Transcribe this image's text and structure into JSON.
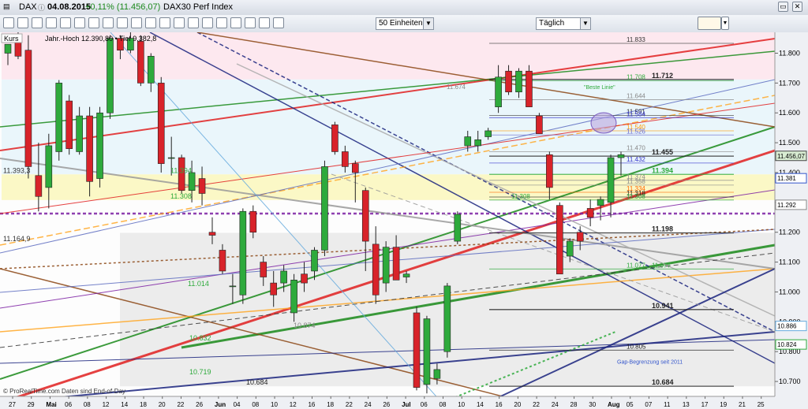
{
  "window": {
    "symbol": "DAX",
    "date": "04.08.2015",
    "change": "+0,11% (11.456,07)",
    "index_name": "DAX30 Perf Index"
  },
  "toolbar": {
    "units_select": "50 Einheiten",
    "period_select": "Täglich"
  },
  "chart_panel": {
    "panel_label": "Kurs",
    "info": "Jahr.-Hoch 12.390,80 • Tief 9.382,8",
    "footer_left": "© ProRealTime.com  Daten sind End-of-Day"
  },
  "colors": {
    "bull": "#2eaa3c",
    "bear": "#d8232a",
    "price_tag": "#d8ecd2",
    "accent_red": "#e02020",
    "accent_green": "#1a8a1a"
  },
  "chart_data": {
    "type": "candlestick",
    "x_ticks": [
      "27",
      "29",
      "Mai",
      "06",
      "08",
      "12",
      "14",
      "18",
      "20",
      "22",
      "26",
      "Jun",
      "04",
      "08",
      "10",
      "12",
      "16",
      "18",
      "22",
      "24",
      "26",
      "Jul",
      "06",
      "08",
      "10",
      "14",
      "16",
      "20",
      "22",
      "24",
      "28",
      "30",
      "Aug",
      "05",
      "07",
      "11",
      "13",
      "17",
      "19",
      "21",
      "25"
    ],
    "ylim": [
      10650,
      11870
    ],
    "y_ticks": [
      "10.700",
      "10.800",
      "10.900",
      "11.000",
      "11.100",
      "11.200",
      "11.300",
      "11.400",
      "11.500",
      "11.600",
      "11.700",
      "11.800"
    ],
    "candles": [
      {
        "o": 11800,
        "h": 11830,
        "l": 11760,
        "c": 11830
      },
      {
        "o": 11840,
        "h": 11870,
        "l": 11780,
        "c": 11790
      },
      {
        "o": 11810,
        "h": 11860,
        "l": 11380,
        "c": 11420
      },
      {
        "o": 11390,
        "h": 11500,
        "l": 11270,
        "c": 11320
      },
      {
        "o": 11350,
        "h": 11530,
        "l": 11280,
        "c": 11490
      },
      {
        "o": 11470,
        "h": 11710,
        "l": 11440,
        "c": 11700
      },
      {
        "o": 11640,
        "h": 11660,
        "l": 11460,
        "c": 11480
      },
      {
        "o": 11470,
        "h": 11620,
        "l": 11460,
        "c": 11590
      },
      {
        "o": 11590,
        "h": 11620,
        "l": 11320,
        "c": 11370
      },
      {
        "o": 11380,
        "h": 11620,
        "l": 11350,
        "c": 11600
      },
      {
        "o": 11600,
        "h": 11860,
        "l": 11580,
        "c": 11850
      },
      {
        "o": 11850,
        "h": 11860,
        "l": 11780,
        "c": 11810
      },
      {
        "o": 11810,
        "h": 11880,
        "l": 11800,
        "c": 11850
      },
      {
        "o": 11840,
        "h": 11860,
        "l": 11690,
        "c": 11700
      },
      {
        "o": 11700,
        "h": 11800,
        "l": 11670,
        "c": 11790
      },
      {
        "o": 11700,
        "h": 11720,
        "l": 11400,
        "c": 11430
      },
      {
        "o": 11450,
        "h": 11520,
        "l": 11390,
        "c": 11450
      },
      {
        "o": 11450,
        "h": 11460,
        "l": 11330,
        "c": 11340
      },
      {
        "o": 11340,
        "h": 11440,
        "l": 11300,
        "c": 11400
      },
      {
        "o": 11380,
        "h": 11420,
        "l": 11290,
        "c": 11330
      },
      {
        "o": 11200,
        "h": 11250,
        "l": 11160,
        "c": 11190
      },
      {
        "o": 11140,
        "h": 11160,
        "l": 11060,
        "c": 11070
      },
      {
        "o": 11020,
        "h": 11060,
        "l": 10960,
        "c": 11020
      },
      {
        "o": 10990,
        "h": 11280,
        "l": 10960,
        "c": 11270
      },
      {
        "o": 11270,
        "h": 11290,
        "l": 11180,
        "c": 11200
      },
      {
        "o": 11100,
        "h": 11120,
        "l": 11020,
        "c": 11050
      },
      {
        "o": 11030,
        "h": 11070,
        "l": 10950,
        "c": 10990
      },
      {
        "o": 11030,
        "h": 11090,
        "l": 11000,
        "c": 11070
      },
      {
        "o": 10930,
        "h": 11060,
        "l": 10900,
        "c": 11040
      },
      {
        "o": 11060,
        "h": 11100,
        "l": 11000,
        "c": 11030
      },
      {
        "o": 11070,
        "h": 11150,
        "l": 11040,
        "c": 11140
      },
      {
        "o": 11140,
        "h": 11440,
        "l": 11120,
        "c": 11420
      },
      {
        "o": 11560,
        "h": 11570,
        "l": 11460,
        "c": 11470
      },
      {
        "o": 11470,
        "h": 11490,
        "l": 11400,
        "c": 11420
      },
      {
        "o": 11430,
        "h": 11440,
        "l": 11300,
        "c": 11400
      },
      {
        "o": 11340,
        "h": 11350,
        "l": 11070,
        "c": 11170
      },
      {
        "o": 11160,
        "h": 11220,
        "l": 10960,
        "c": 10990
      },
      {
        "o": 11030,
        "h": 11170,
        "l": 11000,
        "c": 11150
      },
      {
        "o": 11150,
        "h": 11190,
        "l": 11080,
        "c": 11040
      },
      {
        "o": 11050,
        "h": 11070,
        "l": 11030,
        "c": 11060
      },
      {
        "o": 10930,
        "h": 10950,
        "l": 10670,
        "c": 10680
      },
      {
        "o": 10690,
        "h": 10920,
        "l": 10660,
        "c": 10910
      },
      {
        "o": 10710,
        "h": 10760,
        "l": 10690,
        "c": 10740
      },
      {
        "o": 10800,
        "h": 11030,
        "l": 10780,
        "c": 11020
      },
      {
        "o": 11170,
        "h": 11270,
        "l": 11160,
        "c": 11260
      },
      {
        "o": 11490,
        "h": 11540,
        "l": 11470,
        "c": 11520
      },
      {
        "o": 11490,
        "h": 11540,
        "l": 11470,
        "c": 11510
      },
      {
        "o": 11520,
        "h": 11550,
        "l": 11510,
        "c": 11540
      },
      {
        "o": 11620,
        "h": 11760,
        "l": 11600,
        "c": 11720
      },
      {
        "o": 11740,
        "h": 11760,
        "l": 11660,
        "c": 11670
      },
      {
        "o": 11670,
        "h": 11750,
        "l": 11650,
        "c": 11740
      },
      {
        "o": 11740,
        "h": 11760,
        "l": 11620,
        "c": 11620
      },
      {
        "o": 11590,
        "h": 11600,
        "l": 11530,
        "c": 11530
      },
      {
        "o": 11460,
        "h": 11470,
        "l": 11310,
        "c": 11350
      },
      {
        "o": 11290,
        "h": 11300,
        "l": 11060,
        "c": 11060
      },
      {
        "o": 11120,
        "h": 11180,
        "l": 11100,
        "c": 11170
      },
      {
        "o": 11200,
        "h": 11220,
        "l": 11140,
        "c": 11170
      },
      {
        "o": 11280,
        "h": 11310,
        "l": 11220,
        "c": 11250
      },
      {
        "o": 11290,
        "h": 11320,
        "l": 11240,
        "c": 11310
      },
      {
        "o": 11300,
        "h": 11460,
        "l": 11250,
        "c": 11450
      },
      {
        "o": 11450,
        "h": 11470,
        "l": 11390,
        "c": 11460
      }
    ],
    "levels": [
      {
        "value": 11833,
        "label": "11.833",
        "color": "#333333",
        "bold": false
      },
      {
        "value": 11712,
        "label": "11.712",
        "color": "#222222",
        "bold": true
      },
      {
        "value": 11708,
        "label": "11.708",
        "color": "#2eaa3c",
        "bold": false
      },
      {
        "value": 11644,
        "label": "11.644",
        "color": "#888888",
        "bold": false
      },
      {
        "value": 11591,
        "label": "11.591",
        "color": "#333333",
        "bold": false
      },
      {
        "value": 11584,
        "label": "11.584",
        "color": "#3333cc",
        "bold": false
      },
      {
        "value": 11540,
        "label": "11.540",
        "color": "#ff9900",
        "bold": false
      },
      {
        "value": 11526,
        "label": "11.526",
        "color": "#6666cc",
        "bold": false
      },
      {
        "value": 11470,
        "label": "11.470",
        "color": "#888888",
        "bold": false
      },
      {
        "value": 11455,
        "label": "11.455",
        "color": "#222222",
        "bold": true
      },
      {
        "value": 11432,
        "label": "11.432",
        "color": "#3333cc",
        "bold": false
      },
      {
        "value": 11394,
        "label": "11.394",
        "color": "#2eaa3c",
        "bold": true
      },
      {
        "value": 11374,
        "label": "11.374",
        "color": "#888888",
        "bold": false
      },
      {
        "value": 11358,
        "label": "11.358",
        "color": "#888888",
        "bold": false
      },
      {
        "value": 11334,
        "label": "11.334",
        "color": "#ff6600",
        "bold": false
      },
      {
        "value": 11318,
        "label": "11.318",
        "color": "#222222",
        "bold": false
      },
      {
        "value": 11308,
        "label": "11.308",
        "color": "#2eaa3c",
        "bold": false
      },
      {
        "value": 11198,
        "label": "11.198",
        "color": "#222222",
        "bold": true
      },
      {
        "value": 11077,
        "label": "11.077",
        "color": "#2eaa3c",
        "bold": false
      },
      {
        "value": 10941,
        "label": "10.941",
        "color": "#222222",
        "bold": true
      },
      {
        "value": 10805,
        "label": "10.805",
        "color": "#222222",
        "bold": false
      },
      {
        "value": 10684,
        "label": "10.684",
        "color": "#222222",
        "bold": true
      }
    ],
    "left_labels": [
      {
        "value": 11394,
        "label": "11.394",
        "color": "#2eaa3c"
      },
      {
        "value": 11393.3,
        "label": "11.393,3",
        "color": "#333333"
      },
      {
        "value": 11308,
        "label": "11.308",
        "color": "#2eaa3c"
      },
      {
        "value": 11164.9,
        "label": "11.164,9",
        "color": "#333333"
      },
      {
        "value": 11014,
        "label": "11.014",
        "color": "#2eaa3c"
      },
      {
        "value": 10874,
        "label": "10.874",
        "color": "#888888"
      },
      {
        "value": 10832,
        "label": "10.832",
        "color": "#2eaa3c"
      },
      {
        "value": 10719,
        "label": "10.719",
        "color": "#2eaa3c"
      },
      {
        "value": 10684,
        "label": "10.684",
        "color": "#222222"
      }
    ],
    "mid_labels": [
      {
        "value": 11674,
        "label": "11.674",
        "color": "#888888"
      },
      {
        "value": 11308,
        "label": "11.308",
        "color": "#2eaa3c"
      },
      {
        "value": 11077,
        "label": "11.077",
        "color": "#2eaa3c"
      }
    ],
    "annotations": [
      {
        "text": "\"Beste Linie\"",
        "value": 11680,
        "color": "#2eaa3c"
      },
      {
        "text": "Gap-Begrenzung seit 2011",
        "value": 10760,
        "color": "#3355cc"
      }
    ],
    "right_tags": [
      {
        "value": 11456.07,
        "label": "11.456,07",
        "bg": "#d8ecd2",
        "border": "#444444"
      },
      {
        "value": 11381,
        "label": "11.381",
        "bg": "#ffffff",
        "border": "#3355cc"
      },
      {
        "value": 11292,
        "label": "11.292",
        "bg": "#ffffff",
        "border": "#888888"
      },
      {
        "value": 10886,
        "label": "10.886",
        "bg": "#ffffff",
        "border": "#66aadd"
      },
      {
        "value": 10824,
        "label": "10.824",
        "bg": "#ffffff",
        "border": "#2eaa3c"
      }
    ]
  }
}
